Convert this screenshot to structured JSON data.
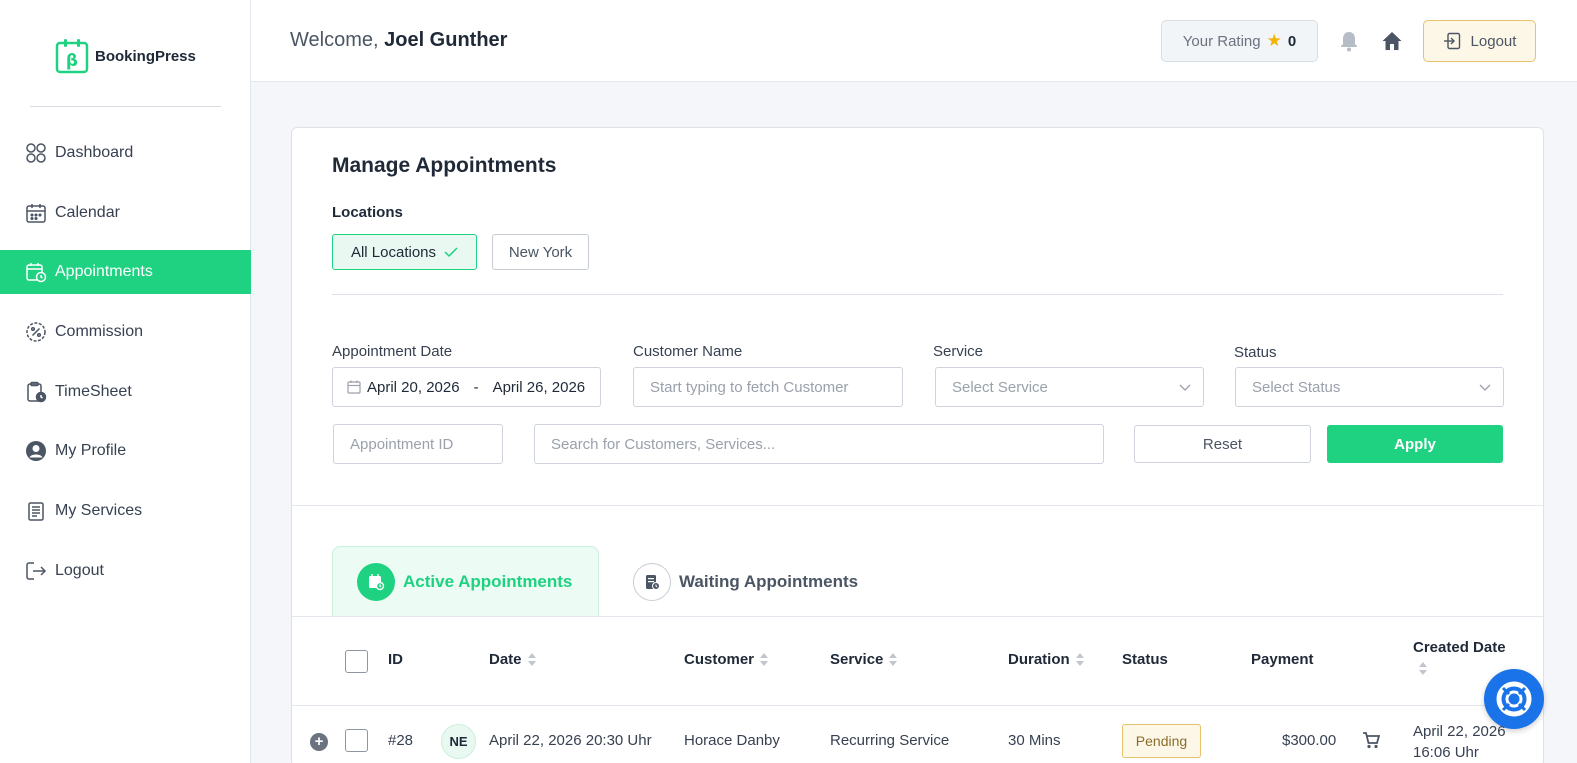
{
  "brand": {
    "name": "BookingPress",
    "accent": "#1ed281"
  },
  "sidebar": {
    "items": [
      {
        "label": "Dashboard",
        "icon": "dashboard-icon"
      },
      {
        "label": "Calendar",
        "icon": "calendar-icon"
      },
      {
        "label": "Appointments",
        "icon": "appointments-icon",
        "active": true
      },
      {
        "label": "Commission",
        "icon": "commission-icon"
      },
      {
        "label": "TimeSheet",
        "icon": "timesheet-icon"
      },
      {
        "label": "My Profile",
        "icon": "profile-icon"
      },
      {
        "label": "My Services",
        "icon": "services-icon"
      },
      {
        "label": "Logout",
        "icon": "logout-icon"
      }
    ]
  },
  "header": {
    "welcome_prefix": "Welcome,",
    "user_name": "Joel Gunther",
    "rating_label": "Your Rating",
    "rating_value": "0",
    "logout_label": "Logout"
  },
  "main": {
    "title": "Manage Appointments",
    "locations_label": "Locations",
    "locations": [
      "All Locations",
      "New York"
    ],
    "filters": {
      "date_label": "Appointment Date",
      "date_from": "April 20, 2026",
      "date_sep": "-",
      "date_to": "April 26, 2026",
      "customer_label": "Customer Name",
      "customer_placeholder": "Start typing to fetch Customer",
      "service_label": "Service",
      "service_placeholder": "Select Service",
      "status_label": "Status",
      "status_placeholder": "Select Status",
      "id_placeholder": "Appointment ID",
      "search_placeholder": "Search for Customers, Services...",
      "reset_label": "Reset",
      "apply_label": "Apply"
    },
    "tabs": [
      {
        "label": "Active Appointments",
        "active": true
      },
      {
        "label": "Waiting Appointments",
        "active": false
      }
    ],
    "table": {
      "headers": [
        "ID",
        "Date",
        "Customer",
        "Service",
        "Duration",
        "Status",
        "Payment",
        "Created Date"
      ],
      "rows": [
        {
          "id": "#28",
          "initials": "NE",
          "date": "April 22, 2026 20:30 Uhr",
          "customer": "Horace Danby",
          "service": "Recurring Service",
          "duration": "30 Mins",
          "status": "Pending",
          "payment": "$300.00",
          "created_date": "April 22, 2026 16:06 Uhr"
        }
      ]
    }
  }
}
